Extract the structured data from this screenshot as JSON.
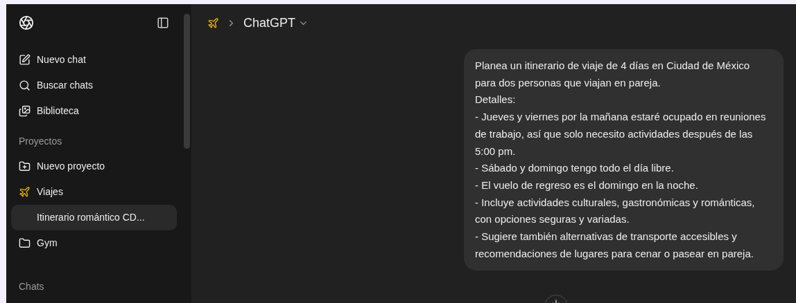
{
  "sidebar": {
    "nav": [
      {
        "kind": "new",
        "label": "Nuevo chat"
      },
      {
        "kind": "search",
        "label": "Buscar chats"
      },
      {
        "kind": "library",
        "label": "Biblioteca"
      }
    ],
    "projects_heading": "Proyectos",
    "projects": [
      {
        "kind": "new",
        "label": "Nuevo proyecto",
        "selected": false
      },
      {
        "kind": "project",
        "label": "Viajes",
        "color": "#e2b00f",
        "selected": false,
        "children": [
          {
            "label": "Itinerario romántico CD...",
            "selected": true
          }
        ]
      },
      {
        "kind": "folder",
        "label": "Gym",
        "selected": false
      }
    ],
    "chats_heading": "Chats"
  },
  "header": {
    "model": "ChatGPT"
  },
  "message": {
    "lines": [
      "Planea un itinerario de viaje de 4 días en Ciudad de México para dos personas que viajan en pareja.",
      "Detalles:",
      "- Jueves y viernes por la mañana estaré ocupado en reuniones de trabajo, así que solo necesito actividades después de las 5:00 pm.",
      "- Sábado y domingo tengo todo el día libre.",
      "- El vuelo de regreso es el domingo en la noche.",
      "- Incluye actividades culturales, gastronómicas y románticas, con opciones seguras y variadas.",
      "- Sugiere también alternativas de transporte accesibles y recomendaciones de lugares para cenar o pasear en pareja."
    ]
  }
}
